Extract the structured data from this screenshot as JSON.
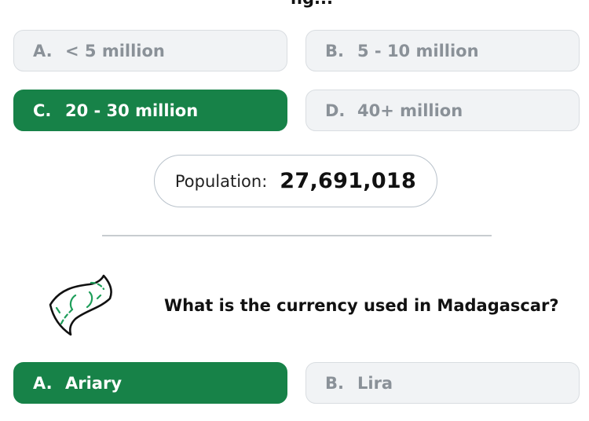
{
  "question1": {
    "clipped_title": "ng...",
    "options": [
      {
        "letter": "A.",
        "text": "< 5 million",
        "selected": false
      },
      {
        "letter": "B.",
        "text": "5 - 10 million",
        "selected": false
      },
      {
        "letter": "C.",
        "text": "20 - 30 million",
        "selected": true
      },
      {
        "letter": "D.",
        "text": "40+ million",
        "selected": false
      }
    ]
  },
  "result": {
    "label": "Population:",
    "value": "27,691,018"
  },
  "question2": {
    "icon": "money-bill-icon",
    "text": "What is the currency used in Madagascar?",
    "options": [
      {
        "letter": "A.",
        "text": "Ariary",
        "selected": true
      },
      {
        "letter": "B.",
        "text": "Lira",
        "selected": false
      }
    ]
  },
  "colors": {
    "selected": "#178248",
    "option_bg": "#f1f3f5",
    "option_text": "#8a9198",
    "divider": "#c8ccd0"
  }
}
